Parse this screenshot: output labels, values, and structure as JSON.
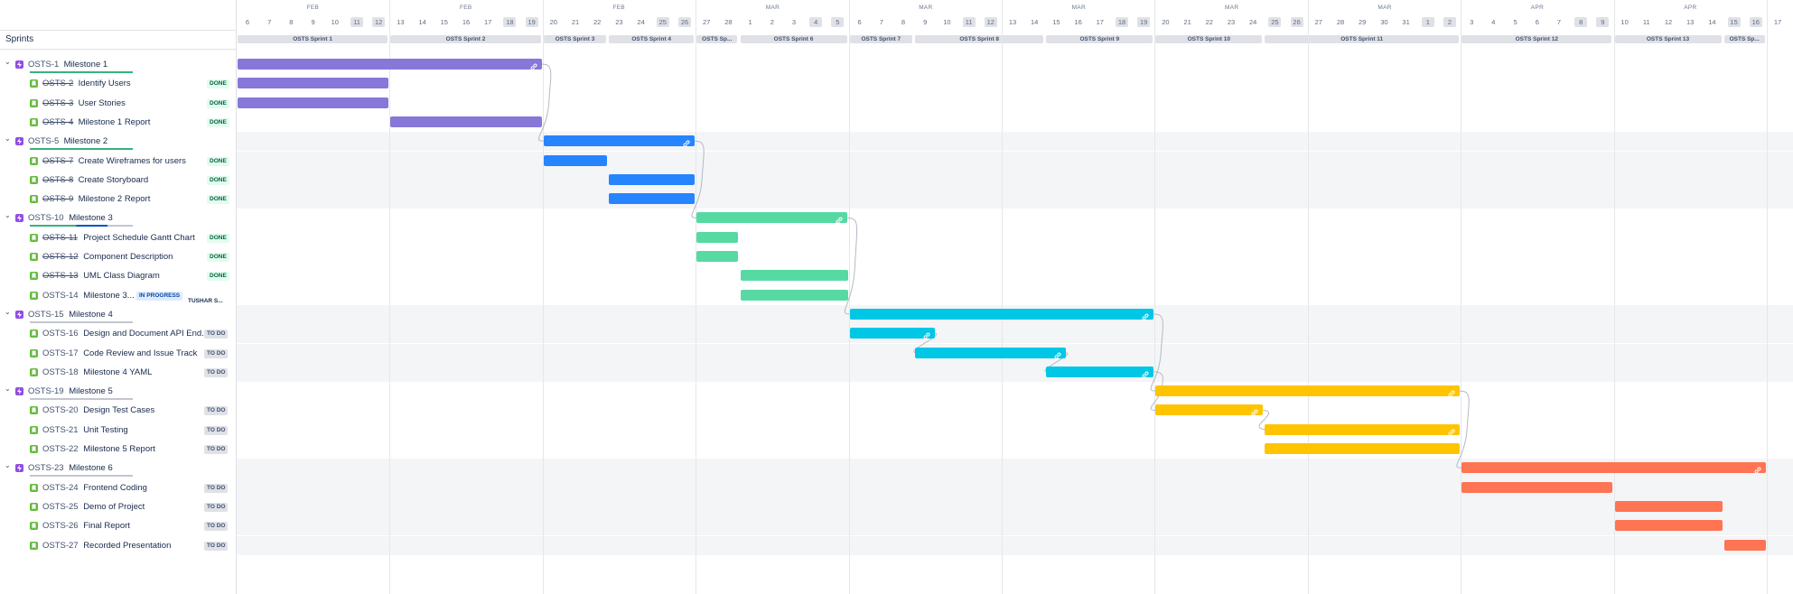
{
  "colors": {
    "milestone1": "#8777d9",
    "milestone2": "#2684ff",
    "milestone3": "#57d9a3",
    "milestone4": "#00c7e6",
    "milestone5": "#ffc400",
    "milestone6": "#ff7452",
    "progress_done": "#36b37e",
    "progress_inprog": "#0052cc",
    "progress_empty": "#c1c7d0",
    "link_line": "#b3bac5"
  },
  "header": {
    "sprints_label": "Sprints",
    "months": [
      {
        "label": "FEB",
        "at": "2023-02-09"
      },
      {
        "label": "FEB",
        "at": "2023-02-16"
      },
      {
        "label": "FEB",
        "at": "2023-02-23"
      },
      {
        "label": "MAR",
        "at": "2023-03-02"
      },
      {
        "label": "MAR",
        "at": "2023-03-09"
      },
      {
        "label": "MAR",
        "at": "2023-03-16"
      },
      {
        "label": "MAR",
        "at": "2023-03-23"
      },
      {
        "label": "MAR",
        "at": "2023-03-30"
      },
      {
        "label": "APR",
        "at": "2023-04-06"
      },
      {
        "label": "APR",
        "at": "2023-04-13"
      }
    ],
    "days": [
      "6",
      "7",
      "8",
      "9",
      "10",
      "11",
      "12",
      "13",
      "14",
      "15",
      "16",
      "17",
      "18",
      "19",
      "20",
      "21",
      "22",
      "23",
      "24",
      "25",
      "26",
      "27",
      "28",
      "1",
      "2",
      "3",
      "4",
      "5",
      "6",
      "7",
      "8",
      "9",
      "10",
      "11",
      "12",
      "13",
      "14",
      "15",
      "16",
      "17",
      "18",
      "19",
      "20",
      "21",
      "22",
      "23",
      "24",
      "25",
      "26",
      "27",
      "28",
      "29",
      "30",
      "31",
      "1",
      "2",
      "3",
      "4",
      "5",
      "6",
      "7",
      "8",
      "9",
      "10",
      "11",
      "12",
      "13",
      "14",
      "15",
      "16",
      "17"
    ],
    "sprints": [
      {
        "label": "OSTS Sprint 1",
        "start": "2023-02-06",
        "end": "2023-02-12"
      },
      {
        "label": "OSTS Sprint 2",
        "start": "2023-02-13",
        "end": "2023-02-19"
      },
      {
        "label": "OSTS Sprint 3",
        "start": "2023-02-20",
        "end": "2023-02-22"
      },
      {
        "label": "OSTS Sprint 4",
        "start": "2023-02-23",
        "end": "2023-02-26"
      },
      {
        "label": "OSTS Sp...",
        "start": "2023-02-27",
        "end": "2023-02-28"
      },
      {
        "label": "OSTS Sprint 6",
        "start": "2023-03-01",
        "end": "2023-03-05"
      },
      {
        "label": "OSTS Sprint 7",
        "start": "2023-03-06",
        "end": "2023-03-08"
      },
      {
        "label": "OSTS Sprint 8",
        "start": "2023-03-09",
        "end": "2023-03-14"
      },
      {
        "label": "OSTS Sprint 9",
        "start": "2023-03-15",
        "end": "2023-03-19"
      },
      {
        "label": "OSTS Sprint 10",
        "start": "2023-03-20",
        "end": "2023-03-24"
      },
      {
        "label": "OSTS Sprint 11",
        "start": "2023-03-25",
        "end": "2023-04-02"
      },
      {
        "label": "OSTS Sprint 12",
        "start": "2023-04-03",
        "end": "2023-04-09"
      },
      {
        "label": "OSTS Sprint 13",
        "start": "2023-04-10",
        "end": "2023-04-14"
      },
      {
        "label": "OSTS Sp...",
        "start": "2023-04-15",
        "end": "2023-04-16"
      }
    ]
  },
  "rows": [
    {
      "key": "OSTS-1",
      "summary": "Milestone 1",
      "type": "epic",
      "color": "milestone1",
      "progress": 1,
      "start": "2023-02-06",
      "end": "2023-02-19",
      "link": true
    },
    {
      "key": "OSTS-2",
      "summary": "Identify Users",
      "type": "story",
      "status": "DONE",
      "color": "milestone1",
      "start": "2023-02-06",
      "end": "2023-02-12"
    },
    {
      "key": "OSTS-3",
      "summary": "User Stories",
      "type": "story",
      "status": "DONE",
      "color": "milestone1",
      "start": "2023-02-06",
      "end": "2023-02-12"
    },
    {
      "key": "OSTS-4",
      "summary": "Milestone 1 Report",
      "type": "story",
      "status": "DONE",
      "color": "milestone1",
      "start": "2023-02-13",
      "end": "2023-02-19"
    },
    {
      "key": "OSTS-5",
      "summary": "Milestone 2",
      "type": "epic",
      "color": "milestone2",
      "progress": 1,
      "start": "2023-02-20",
      "end": "2023-02-26",
      "link": true,
      "shaded": true
    },
    {
      "key": "OSTS-7",
      "summary": "Create Wireframes for users",
      "type": "story",
      "status": "DONE",
      "color": "milestone2",
      "start": "2023-02-20",
      "end": "2023-02-22",
      "shaded": true
    },
    {
      "key": "OSTS-8",
      "summary": "Create Storyboard",
      "type": "story",
      "status": "DONE",
      "color": "milestone2",
      "start": "2023-02-23",
      "end": "2023-02-26",
      "shaded": true
    },
    {
      "key": "OSTS-9",
      "summary": "Milestone 2 Report",
      "type": "story",
      "status": "DONE",
      "color": "milestone2",
      "start": "2023-02-23",
      "end": "2023-02-26",
      "shaded": true
    },
    {
      "key": "OSTS-10",
      "summary": "Milestone 3",
      "type": "epic",
      "color": "milestone3",
      "progress": 0.75,
      "start": "2023-02-27",
      "end": "2023-03-05",
      "link": true
    },
    {
      "key": "OSTS-11",
      "summary": "Project Schedule Gantt Chart",
      "type": "story",
      "status": "DONE",
      "color": "milestone3",
      "start": "2023-02-27",
      "end": "2023-02-28"
    },
    {
      "key": "OSTS-12",
      "summary": "Component Description",
      "type": "story",
      "status": "DONE",
      "color": "milestone3",
      "start": "2023-02-27",
      "end": "2023-02-28"
    },
    {
      "key": "OSTS-13",
      "summary": "UML Class Diagram",
      "type": "story",
      "status": "DONE",
      "color": "milestone3",
      "start": "2023-03-01",
      "end": "2023-03-05"
    },
    {
      "key": "OSTS-14",
      "summary": "Milestone 3...",
      "type": "story",
      "status": "IN PROGRESS",
      "assignee": "TUSHAR S...",
      "color": "milestone3",
      "start": "2023-03-01",
      "end": "2023-03-05"
    },
    {
      "key": "OSTS-15",
      "summary": "Milestone 4",
      "type": "epic",
      "color": "milestone4",
      "progress": 0,
      "start": "2023-03-06",
      "end": "2023-03-19",
      "link": true,
      "shaded": true
    },
    {
      "key": "OSTS-16",
      "summary": "Design and Document API End...",
      "type": "story",
      "status": "TO DO",
      "color": "milestone4",
      "start": "2023-03-06",
      "end": "2023-03-09",
      "link": true,
      "shaded": true
    },
    {
      "key": "OSTS-17",
      "summary": "Code Review and Issue Track",
      "type": "story",
      "status": "TO DO",
      "color": "milestone4",
      "start": "2023-03-09",
      "end": "2023-03-15",
      "link": true,
      "shaded": true
    },
    {
      "key": "OSTS-18",
      "summary": "Milestone 4 YAML",
      "type": "story",
      "status": "TO DO",
      "color": "milestone4",
      "start": "2023-03-15",
      "end": "2023-03-19",
      "link": true,
      "shaded": true
    },
    {
      "key": "OSTS-19",
      "summary": "Milestone 5",
      "type": "epic",
      "color": "milestone5",
      "progress": 0,
      "start": "2023-03-20",
      "end": "2023-04-02",
      "link": true
    },
    {
      "key": "OSTS-20",
      "summary": "Design Test Cases",
      "type": "story",
      "status": "TO DO",
      "color": "milestone5",
      "start": "2023-03-20",
      "end": "2023-03-24",
      "link": true
    },
    {
      "key": "OSTS-21",
      "summary": "Unit Testing",
      "type": "story",
      "status": "TO DO",
      "color": "milestone5",
      "start": "2023-03-25",
      "end": "2023-04-02",
      "link": true
    },
    {
      "key": "OSTS-22",
      "summary": "Milestone 5 Report",
      "type": "story",
      "status": "TO DO",
      "color": "milestone5",
      "start": "2023-03-25",
      "end": "2023-04-02"
    },
    {
      "key": "OSTS-23",
      "summary": "Milestone 6",
      "type": "epic",
      "color": "milestone6",
      "progress": 0,
      "start": "2023-04-03",
      "end": "2023-04-16",
      "link": true,
      "shaded": true
    },
    {
      "key": "OSTS-24",
      "summary": "Frontend Coding",
      "type": "story",
      "status": "TO DO",
      "color": "milestone6",
      "start": "2023-04-03",
      "end": "2023-04-09",
      "shaded": true
    },
    {
      "key": "OSTS-25",
      "summary": "Demo of Project",
      "type": "story",
      "status": "TO DO",
      "color": "milestone6",
      "start": "2023-04-10",
      "end": "2023-04-14",
      "shaded": true
    },
    {
      "key": "OSTS-26",
      "summary": "Final Report",
      "type": "story",
      "status": "TO DO",
      "color": "milestone6",
      "start": "2023-04-10",
      "end": "2023-04-14",
      "shaded": true
    },
    {
      "key": "OSTS-27",
      "summary": "Recorded Presentation",
      "type": "story",
      "status": "TO DO",
      "color": "milestone6",
      "start": "2023-04-15",
      "end": "2023-04-16",
      "shaded": true
    }
  ],
  "dependencies": [
    [
      "OSTS-1",
      "OSTS-5"
    ],
    [
      "OSTS-5",
      "OSTS-10"
    ],
    [
      "OSTS-10",
      "OSTS-15"
    ],
    [
      "OSTS-15",
      "OSTS-19"
    ],
    [
      "OSTS-19",
      "OSTS-23"
    ],
    [
      "OSTS-16",
      "OSTS-17"
    ],
    [
      "OSTS-17",
      "OSTS-18"
    ],
    [
      "OSTS-18",
      "OSTS-20"
    ],
    [
      "OSTS-20",
      "OSTS-21"
    ]
  ]
}
